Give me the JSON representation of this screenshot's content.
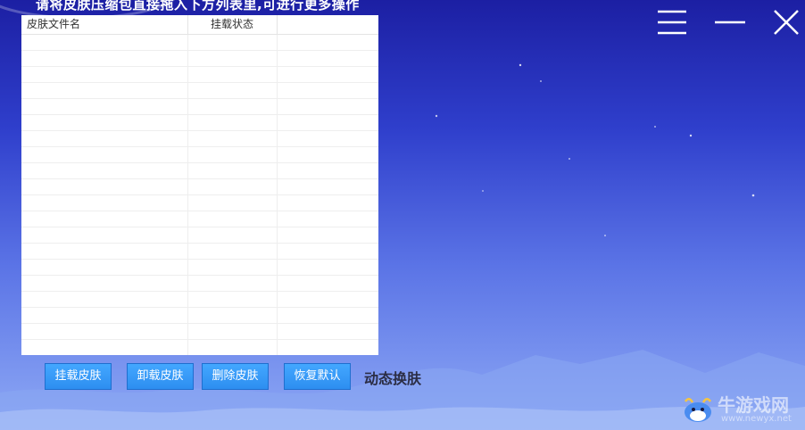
{
  "header": {
    "instruction": "请将皮肤压缩包直接拖入下方列表里,可进行更多操作"
  },
  "window_controls": {
    "menu_icon": "hamburger-menu-icon",
    "minimize_icon": "minimize-icon",
    "close_icon": "close-icon"
  },
  "skin_list": {
    "columns": [
      "皮肤文件名",
      "挂载状态",
      ""
    ],
    "rows": [
      [
        "",
        "",
        ""
      ],
      [
        "",
        "",
        ""
      ],
      [
        "",
        "",
        ""
      ],
      [
        "",
        "",
        ""
      ],
      [
        "",
        "",
        ""
      ],
      [
        "",
        "",
        ""
      ],
      [
        "",
        "",
        ""
      ],
      [
        "",
        "",
        ""
      ],
      [
        "",
        "",
        ""
      ],
      [
        "",
        "",
        ""
      ],
      [
        "",
        "",
        ""
      ],
      [
        "",
        "",
        ""
      ],
      [
        "",
        "",
        ""
      ],
      [
        "",
        "",
        ""
      ],
      [
        "",
        "",
        ""
      ],
      [
        "",
        "",
        ""
      ],
      [
        "",
        "",
        ""
      ],
      [
        "",
        "",
        ""
      ],
      [
        "",
        "",
        ""
      ],
      [
        "",
        "",
        ""
      ]
    ]
  },
  "actions": {
    "mount": "挂载皮肤",
    "unmount": "卸载皮肤",
    "delete": "删除皮肤",
    "restore": "恢复默认",
    "dynamic": "动态换肤"
  },
  "watermark": {
    "name": "牛游戏网",
    "url": "www.newyx.net"
  },
  "colors": {
    "button": "#2d8ef0",
    "background_top": "#1c1fa3",
    "background_bottom": "#8ea9f5"
  }
}
